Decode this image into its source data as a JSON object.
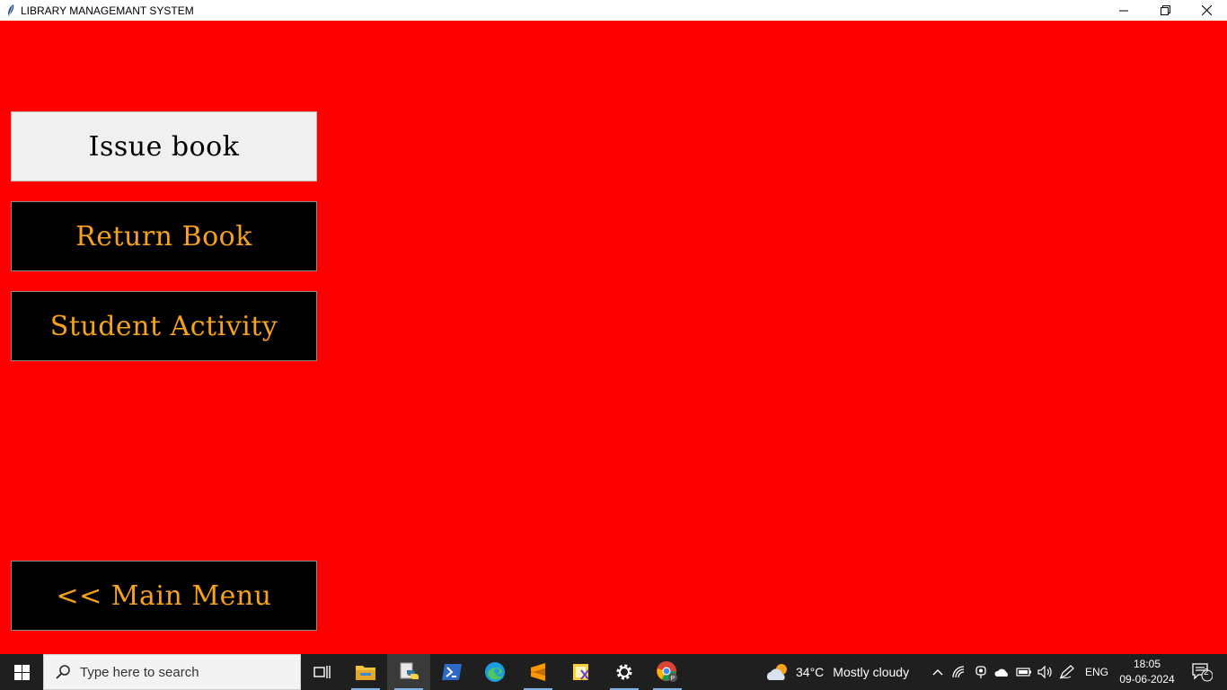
{
  "window": {
    "title": "LIBRARY MANAGEMANT SYSTEM",
    "minimize_icon": "minimize-icon",
    "restore_icon": "restore-icon",
    "close_icon": "close-icon"
  },
  "menu": {
    "issue_book": "Issue book",
    "return_book": "Return Book",
    "student_activity": "Student Activity",
    "main_menu": "<< Main Menu"
  },
  "colors": {
    "background": "#ff0000",
    "button_dark": "#000000",
    "button_text": "#f7a21b",
    "button_light": "#f0f0f0"
  },
  "taskbar": {
    "search_placeholder": "Type here to search",
    "weather_temp": "34°C",
    "weather_desc": "Mostly cloudy",
    "language": "ENG",
    "time": "18:05",
    "date": "09-06-2024",
    "notification_count": "2"
  }
}
